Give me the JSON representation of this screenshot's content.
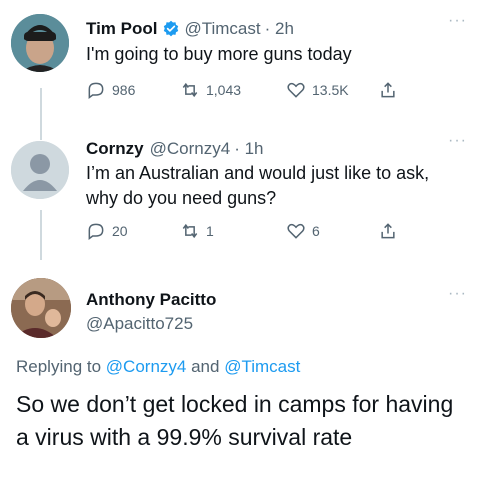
{
  "tweets": [
    {
      "name": "Tim Pool",
      "handle": "@Timcast",
      "time": "· 2h",
      "verified": true,
      "text": "I'm going to buy more guns today",
      "replies": "986",
      "retweets": "1,043",
      "likes": "13.5K"
    },
    {
      "name": "Cornzy",
      "handle": "@Cornzy4",
      "time": "· 1h",
      "verified": false,
      "text": "I’m an Australian and would just like to ask, why do you need guns?",
      "replies": "20",
      "retweets": "1",
      "likes": "6"
    }
  ],
  "main_tweet": {
    "name": "Anthony Pacitto",
    "handle": "@Apacitto725",
    "replying_prefix": "Replying to",
    "reply_user1": "@Cornzy4",
    "reply_and": "and",
    "reply_user2": "@Timcast",
    "text": "So we don’t get locked in camps for having a virus with a 99.9% survival rate"
  },
  "more_label": "···",
  "colors": {
    "link": "#1d9bf0",
    "verified": "#1d9bf0",
    "muted": "#536471",
    "thread_line": "#cfd9de"
  }
}
